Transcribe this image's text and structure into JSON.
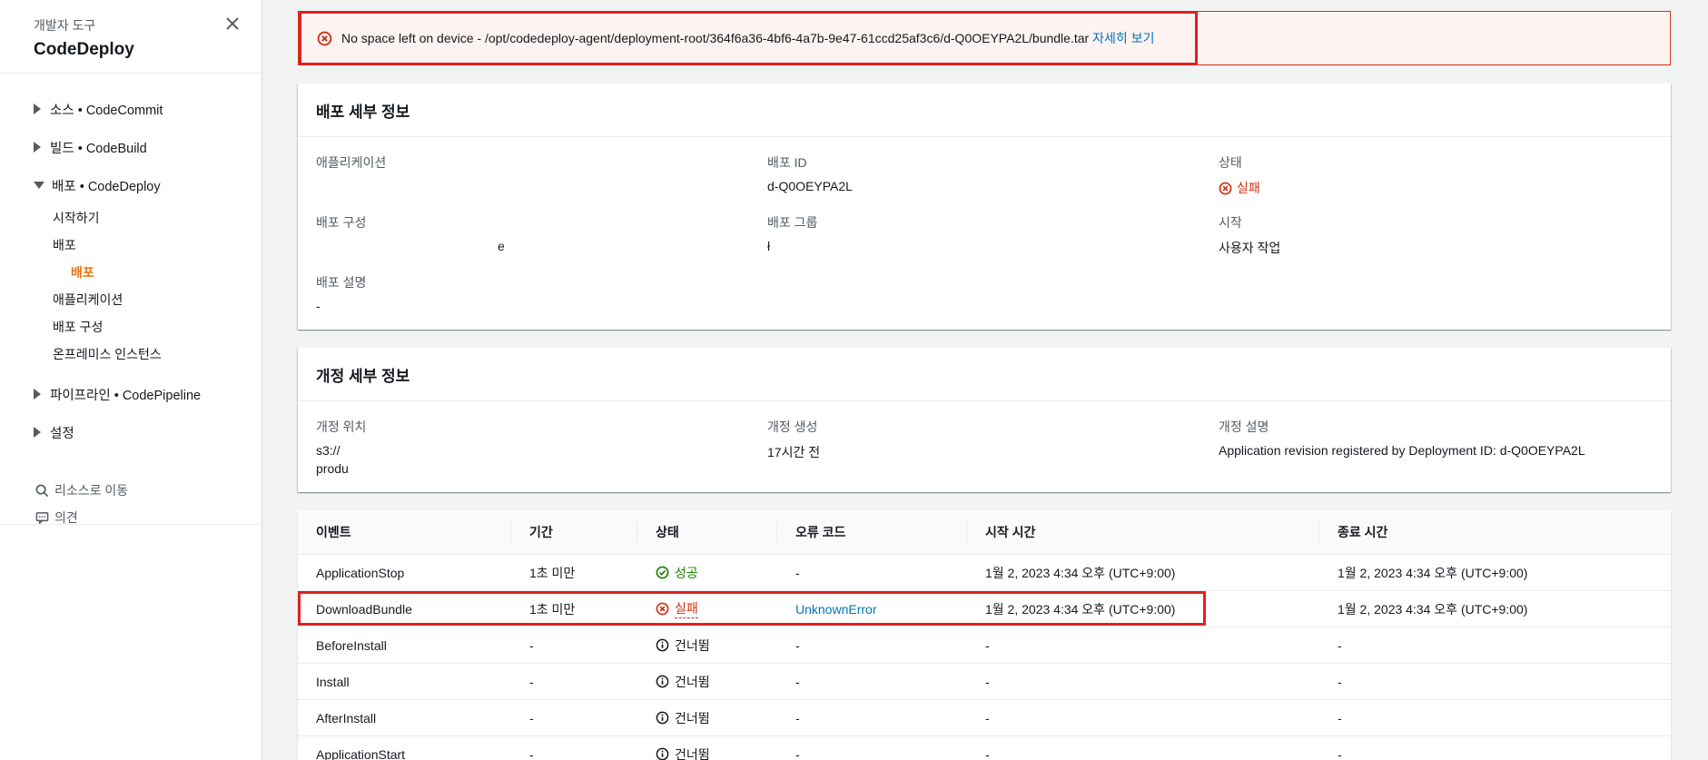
{
  "sidebar": {
    "subtitle": "개발자 도구",
    "title": "CodeDeploy",
    "groups": [
      {
        "label": "소스 • CodeCommit"
      },
      {
        "label": "빌드 • CodeBuild"
      },
      {
        "label": "배포 • CodeDeploy"
      },
      {
        "label": "파이프라인 • CodePipeline"
      },
      {
        "label": "설정"
      }
    ],
    "deploy_items": [
      "시작하기",
      "배포",
      "배포",
      "애플리케이션",
      "배포 구성",
      "온프레미스 인스턴스"
    ],
    "tools": {
      "goto": "리소스로 이동",
      "feedback": "의견"
    }
  },
  "banner": {
    "message": "No space left on device - /opt/codedeploy-agent/deployment-root/364f6a36-4bf6-4a7b-9e47-61ccd25af3c6/d-Q0OEYPA2L/bundle.tar",
    "link": "자세히 보기"
  },
  "deploy_details": {
    "title": "배포 세부 정보",
    "application_label": "애플리케이션",
    "application_value": "",
    "id_label": "배포 ID",
    "id_value": "d-Q0OEYPA2L",
    "status_label": "상태",
    "status_value": "실패",
    "config_label": "배포 구성",
    "config_value": "e",
    "group_label": "배포 그룹",
    "group_value": "ł",
    "start_label": "시작",
    "start_value": "사용자 작업",
    "desc_label": "배포 설명",
    "desc_value": "-"
  },
  "revision_details": {
    "title": "개정 세부 정보",
    "location_label": "개정 위치",
    "location_line1": "s3://",
    "location_line2": "produ",
    "created_label": "개정 생성",
    "created_value": "17시간 전",
    "desc_label": "개정 설명",
    "desc_value": "Application revision registered by Deployment ID: d-Q0OEYPA2L"
  },
  "events": {
    "headers": [
      "이벤트",
      "기간",
      "상태",
      "오류 코드",
      "시작 시간",
      "종료 시간"
    ],
    "rows": [
      {
        "event": "ApplicationStop",
        "duration": "1초 미만",
        "status": "성공",
        "error": "-",
        "start": "1월 2, 2023 4:34 오후 (UTC+9:00)",
        "end": "1월 2, 2023 4:34 오후 (UTC+9:00)"
      },
      {
        "event": "DownloadBundle",
        "duration": "1초 미만",
        "status": "실패",
        "error": "UnknownError",
        "start": "1월 2, 2023 4:34 오후 (UTC+9:00)",
        "end": "1월 2, 2023 4:34 오후 (UTC+9:00)"
      },
      {
        "event": "BeforeInstall",
        "duration": "-",
        "status": "건너뜀",
        "error": "-",
        "start": "-",
        "end": "-"
      },
      {
        "event": "Install",
        "duration": "-",
        "status": "건너뜀",
        "error": "-",
        "start": "-",
        "end": "-"
      },
      {
        "event": "AfterInstall",
        "duration": "-",
        "status": "건너뜀",
        "error": "-",
        "start": "-",
        "end": "-"
      },
      {
        "event": "ApplicationStart",
        "duration": "-",
        "status": "건너뜀",
        "error": "-",
        "start": "-",
        "end": "-"
      }
    ]
  }
}
